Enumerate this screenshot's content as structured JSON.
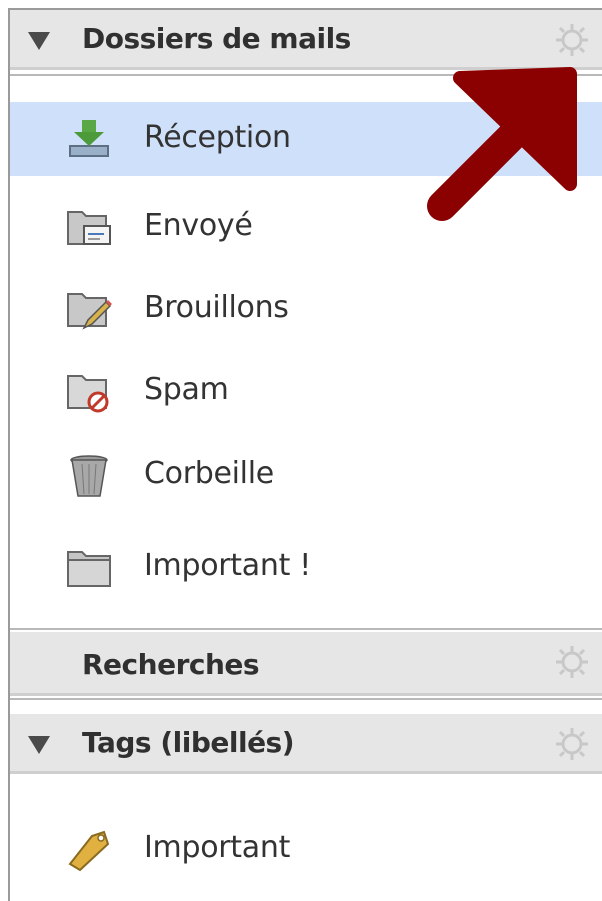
{
  "mail_folders": {
    "header": "Dossiers de mails",
    "items": [
      {
        "label": "Réception",
        "icon": "inbox-download-icon",
        "selected": true
      },
      {
        "label": "Envoyé",
        "icon": "sent-folder-icon"
      },
      {
        "label": "Brouillons",
        "icon": "drafts-folder-icon"
      },
      {
        "label": "Spam",
        "icon": "spam-folder-icon"
      },
      {
        "label": "Corbeille",
        "icon": "trash-icon"
      },
      {
        "label": "Important !",
        "icon": "folder-icon"
      }
    ]
  },
  "searches": {
    "header": "Recherches"
  },
  "tags": {
    "header": "Tags (libellés)",
    "items": [
      {
        "label": "Important",
        "icon": "tag-icon"
      }
    ]
  },
  "colors": {
    "selected_row": "#cfe0fa",
    "header_bg": "#e6e6e6",
    "annotation_arrow": "#8b0000"
  }
}
